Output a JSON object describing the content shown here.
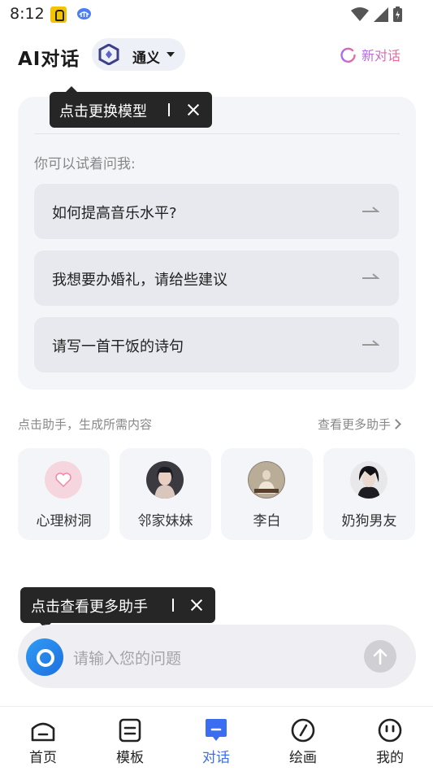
{
  "status_bar": {
    "time": "8:12",
    "icons": [
      "app-notification-icon",
      "cloud-icon",
      "wifi-icon",
      "signal-icon",
      "battery-icon"
    ]
  },
  "header": {
    "title": "AI对话",
    "model_name": "通义",
    "new_chat_label": "新对话"
  },
  "tooltips": {
    "model_tip": "点击更换模型",
    "assistant_tip": "点击查看更多助手"
  },
  "suggestions": {
    "hint": "你可以试着问我:",
    "items": [
      {
        "text": "如何提高音乐水平?"
      },
      {
        "text": "我想要办婚礼，请给些建议"
      },
      {
        "text": "请写一首干饭的诗句"
      }
    ]
  },
  "assistants": {
    "caption": "点击助手，生成所需内容",
    "more_label": "查看更多助手",
    "items": [
      {
        "name": "心理树洞"
      },
      {
        "name": "邻家妹妹"
      },
      {
        "name": "李白"
      },
      {
        "name": "奶狗男友"
      }
    ]
  },
  "input": {
    "placeholder": "请输入您的问题"
  },
  "bottom_nav": {
    "items": [
      {
        "label": "首页",
        "icon": "home-icon"
      },
      {
        "label": "模板",
        "icon": "template-icon"
      },
      {
        "label": "对话",
        "icon": "chat-icon",
        "active": true
      },
      {
        "label": "绘画",
        "icon": "draw-icon"
      },
      {
        "label": "我的",
        "icon": "profile-icon"
      }
    ]
  },
  "colors": {
    "accent": "#3b6df0",
    "tooltip_bg": "#262626",
    "card_bg": "#f4f5f9",
    "new_chat_gradient": [
      "#a86cf0",
      "#ef6b8e"
    ]
  }
}
